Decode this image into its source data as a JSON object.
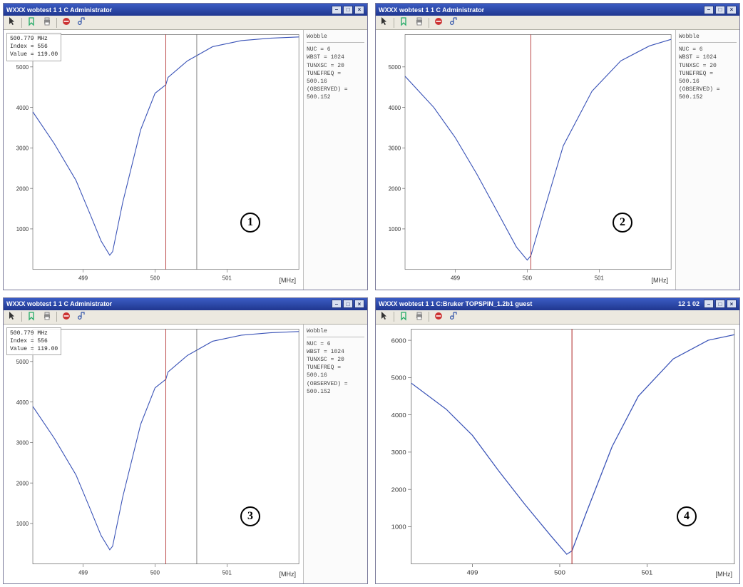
{
  "panels": [
    {
      "title": "WXXX wobtest 1 1 C Administrator",
      "badge": "1",
      "tl_box": [
        "500.779 MHz",
        "Index = 556",
        "Value = 119.00"
      ],
      "side_title": "Wobble",
      "side_lines": [
        "NUC = 6",
        "WBST = 1024",
        "TUNXSC = 20",
        "TUNEFREQ = 500.16",
        "(OBSERVED) = 500.152"
      ],
      "cursor_x": 500.15,
      "ref_x": 500.58,
      "x_ticks": [
        499,
        500,
        501
      ],
      "x_axis_unit": "[MHz]"
    },
    {
      "title": "WXXX wobtest 1 1 C Administrator",
      "badge": "2",
      "tl_box": null,
      "side_title": "Wobble",
      "side_lines": [
        "NUC = 6",
        "WBST = 1024",
        "TUNXSC = 20",
        "TUNEFREQ = 500.16",
        "(OBSERVED) = 500.152"
      ],
      "cursor_x": 500.05,
      "ref_x": null,
      "x_ticks": [
        499,
        500,
        501
      ],
      "x_axis_unit": "[MHz]"
    },
    {
      "title": "WXXX wobtest 1 1 C Administrator",
      "badge": "3",
      "tl_box": [
        "500.779 MHz",
        "Index = 556",
        "Value = 119.00"
      ],
      "side_title": "Wobble",
      "side_lines": [
        "NUC = 6",
        "WBST = 1024",
        "TUNXSC = 20",
        "TUNEFREQ = 500.16",
        "(OBSERVED) = 500.152"
      ],
      "cursor_x": 500.15,
      "ref_x": 500.58,
      "x_ticks": [
        499,
        500,
        501
      ],
      "x_axis_unit": "[MHz]"
    },
    {
      "title": "WXXX wobtest 1 1 C:Bruker TOPSPIN_1.2b1 guest",
      "badge": "4",
      "tl_box": null,
      "side_title": null,
      "side_lines": null,
      "cursor_x": 500.14,
      "ref_x": null,
      "x_ticks": [
        499,
        500,
        501
      ],
      "x_axis_unit": "[MHz]",
      "title_right": "12 1 02"
    }
  ],
  "chart_data": [
    {
      "type": "line",
      "title": "Wobble curve 1",
      "xlabel": "MHz",
      "ylabel": "",
      "xlim": [
        498.3,
        502.0
      ],
      "ylim": [
        0,
        5800
      ],
      "y_ticks": [
        1000,
        2000,
        3000,
        4000,
        5000
      ],
      "series": [
        {
          "name": "wobble",
          "x": [
            498.3,
            498.6,
            498.9,
            499.1,
            499.25,
            499.37,
            499.41,
            499.55,
            499.8,
            500.0,
            500.15,
            500.18,
            500.45,
            500.8,
            501.2,
            501.6,
            502.0
          ],
          "values": [
            3890,
            3100,
            2200,
            1350,
            700,
            350,
            440,
            1650,
            3450,
            4350,
            4560,
            4740,
            5150,
            5500,
            5650,
            5710,
            5740
          ]
        }
      ]
    },
    {
      "type": "line",
      "title": "Wobble curve 2",
      "xlabel": "MHz",
      "ylabel": "",
      "xlim": [
        498.3,
        502.0
      ],
      "ylim": [
        0,
        5800
      ],
      "y_ticks": [
        1000,
        2000,
        3000,
        4000,
        5000
      ],
      "series": [
        {
          "name": "wobble",
          "x": [
            498.3,
            498.7,
            499.0,
            499.3,
            499.6,
            499.85,
            500.0,
            500.05,
            500.2,
            500.5,
            500.9,
            501.3,
            501.7,
            502.0
          ],
          "values": [
            4770,
            4000,
            3250,
            2350,
            1370,
            550,
            230,
            340,
            1250,
            3050,
            4400,
            5150,
            5520,
            5680
          ]
        }
      ]
    },
    {
      "type": "line",
      "title": "Wobble curve 3",
      "xlabel": "MHz",
      "ylabel": "",
      "xlim": [
        498.3,
        502.0
      ],
      "ylim": [
        0,
        5800
      ],
      "y_ticks": [
        1000,
        2000,
        3000,
        4000,
        5000
      ],
      "series": [
        {
          "name": "wobble",
          "x": [
            498.3,
            498.6,
            498.9,
            499.1,
            499.25,
            499.37,
            499.41,
            499.55,
            499.8,
            500.0,
            500.15,
            500.18,
            500.45,
            500.8,
            501.2,
            501.6,
            502.0
          ],
          "values": [
            3890,
            3100,
            2200,
            1350,
            700,
            350,
            440,
            1650,
            3450,
            4350,
            4560,
            4740,
            5150,
            5500,
            5650,
            5710,
            5740
          ]
        }
      ]
    },
    {
      "type": "line",
      "title": "Wobble curve 4",
      "xlabel": "MHz",
      "ylabel": "",
      "xlim": [
        498.3,
        502.0
      ],
      "ylim": [
        0,
        6300
      ],
      "y_ticks": [
        1000,
        2000,
        3000,
        4000,
        5000,
        6000
      ],
      "series": [
        {
          "name": "wobble",
          "x": [
            498.3,
            498.7,
            499.0,
            499.3,
            499.6,
            499.9,
            500.08,
            500.14,
            500.3,
            500.6,
            500.9,
            501.3,
            501.7,
            502.0
          ],
          "values": [
            4850,
            4150,
            3450,
            2500,
            1600,
            750,
            260,
            350,
            1350,
            3150,
            4500,
            5500,
            6000,
            6150
          ]
        }
      ]
    }
  ],
  "colors": {
    "titlebar_start": "#3b5cc4",
    "titlebar_end": "#20378f",
    "curve": "#3a53b7",
    "cursor": "#b23030",
    "ref_line": "#666666",
    "axis": "#555555"
  },
  "toolbar_icons": [
    "cursor-icon",
    "bookmark-icon",
    "print-icon",
    "stop-icon",
    "note-icon"
  ]
}
